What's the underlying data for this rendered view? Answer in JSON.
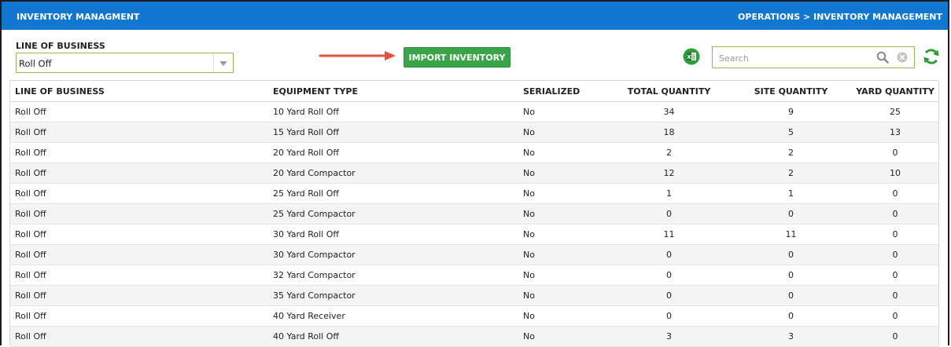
{
  "header": {
    "title": "INVENTORY MANAGMENT",
    "breadcrumb": "OPERATIONS > INVENTORY MANAGEMENT"
  },
  "filter": {
    "label": "LINE OF BUSINESS",
    "selected": "Roll Off"
  },
  "toolbar": {
    "import_label": "IMPORT INVENTORY",
    "search_placeholder": "Search",
    "search_value": "",
    "excel_icon": "excel-export-icon",
    "refresh_icon": "refresh-icon"
  },
  "colors": {
    "titlebar": "#1177d1",
    "button": "#3aa449",
    "arrow": "#e8503a",
    "accent_green": "#2e9e3b"
  },
  "table": {
    "columns": [
      "LINE OF BUSINESS",
      "EQUIPMENT TYPE",
      "SERIALIZED",
      "TOTAL QUANTITY",
      "SITE QUANTITY",
      "YARD QUANTITY"
    ],
    "rows": [
      [
        "Roll Off",
        "10 Yard Roll Off",
        "No",
        "34",
        "9",
        "25"
      ],
      [
        "Roll Off",
        "15 Yard Roll Off",
        "No",
        "18",
        "5",
        "13"
      ],
      [
        "Roll Off",
        "20 Yard Roll Off",
        "No",
        "2",
        "2",
        "0"
      ],
      [
        "Roll Off",
        "20 Yard Compactor",
        "No",
        "12",
        "2",
        "10"
      ],
      [
        "Roll Off",
        "25 Yard Roll Off",
        "No",
        "1",
        "1",
        "0"
      ],
      [
        "Roll Off",
        "25 Yard Compactor",
        "No",
        "0",
        "0",
        "0"
      ],
      [
        "Roll Off",
        "30 Yard Roll Off",
        "No",
        "11",
        "11",
        "0"
      ],
      [
        "Roll Off",
        "30 Yard Compactor",
        "No",
        "0",
        "0",
        "0"
      ],
      [
        "Roll Off",
        "32 Yard Compactor",
        "No",
        "0",
        "0",
        "0"
      ],
      [
        "Roll Off",
        "35 Yard Compactor",
        "No",
        "0",
        "0",
        "0"
      ],
      [
        "Roll Off",
        "40 Yard Receiver",
        "No",
        "0",
        "0",
        "0"
      ],
      [
        "Roll Off",
        "40 Yard Roll Off",
        "No",
        "3",
        "3",
        "0"
      ]
    ]
  }
}
